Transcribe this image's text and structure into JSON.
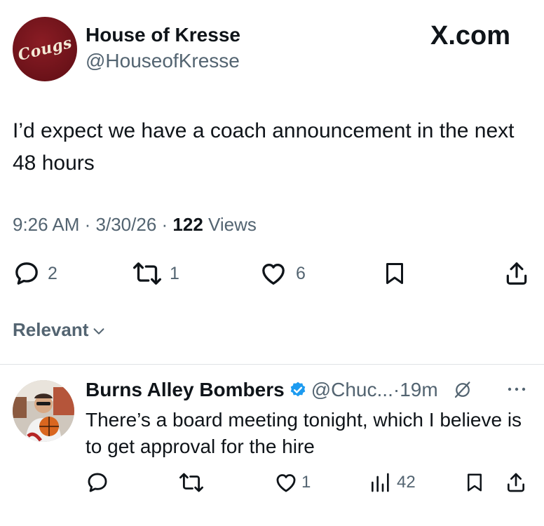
{
  "brand": "X.com",
  "post": {
    "display_name": "House of Kresse",
    "handle": "@HouseofKresse",
    "avatar_text": "Cougs",
    "text": "I’d expect we have a coach announcement in the next 48 hours",
    "time": "9:26 AM",
    "date": "3/30/26",
    "views_count": "122",
    "views_label": "Views",
    "replies": "2",
    "reposts": "1",
    "likes": "6",
    "icons": [
      "reply-icon",
      "repost-icon",
      "like-icon",
      "bookmark-icon",
      "share-icon"
    ]
  },
  "sort": {
    "label": "Relevant"
  },
  "reply": {
    "display_name": "Burns Alley Bombers",
    "verified": true,
    "handle": "@Chuc...",
    "time": "19m",
    "text": "There’s a board meeting tonight, which I believe is to get approval for the hire",
    "likes": "1",
    "views": "42",
    "icons": [
      "reply-icon",
      "repost-icon",
      "like-icon",
      "analytics-icon",
      "bookmark-icon",
      "share-icon",
      "grok-icon",
      "more-icon",
      "verified-icon"
    ]
  },
  "colors": {
    "text": "#0f1419",
    "secondary": "#536471",
    "verified": "#1d9bf0",
    "avatar_maroon": "#6b1219"
  }
}
